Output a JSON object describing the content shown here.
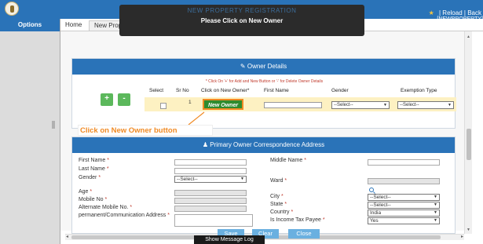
{
  "header": {
    "title": "NEW PROPERTY REGISTRATION",
    "reload": "Reload",
    "separator": "|",
    "back": "Back",
    "sub": "[NEWPROPERTY]"
  },
  "sidebar": {
    "title": "Options"
  },
  "tabs": [
    {
      "label": "Home"
    },
    {
      "label": "New Property Registration"
    }
  ],
  "toast": {
    "message": "Please Click on New Owner"
  },
  "owner_details": {
    "title": "Owner Details",
    "hint": "* Click On '+' for Add and New Button or '-' for Delete Owner Details",
    "add_label": "+",
    "remove_label": "-",
    "columns": [
      "Select",
      "Sr No",
      "Click on New Owner*",
      "First Name",
      "Gender",
      "Exemption Type"
    ],
    "row": {
      "sr_no": "1",
      "new_owner_label": "New Owner",
      "first_name": "",
      "gender": "--Select--",
      "exemption": "--Select--"
    }
  },
  "callout": "Click on New Owner button",
  "correspondence": {
    "title": "Primary Owner Correspondence Address",
    "left": {
      "first_name": "First Name",
      "last_name": "Last Name",
      "gender": "Gender",
      "gender_value": "--Select--",
      "age": "Age",
      "mobile": "Mobile No",
      "alt_mobile": "Alternate Mobile No.",
      "address": "permanent/Communication Address"
    },
    "right": {
      "middle_name": "Middle Name",
      "ward": "Ward",
      "city": "City",
      "city_value": "--Select--",
      "state": "State",
      "state_value": "--Select--",
      "country": "Country",
      "country_value": "India",
      "tax_payee": "Is Income Tax Payee",
      "tax_payee_value": "Yes"
    },
    "required_mark": "*"
  },
  "actions": {
    "save": "Save",
    "clear": "Clear",
    "close": "Close"
  },
  "footer": {
    "message_log": "Show Message Log"
  },
  "colors": {
    "primary": "#2a73b8",
    "accent": "#f08a24",
    "success": "#2e8b2e"
  }
}
